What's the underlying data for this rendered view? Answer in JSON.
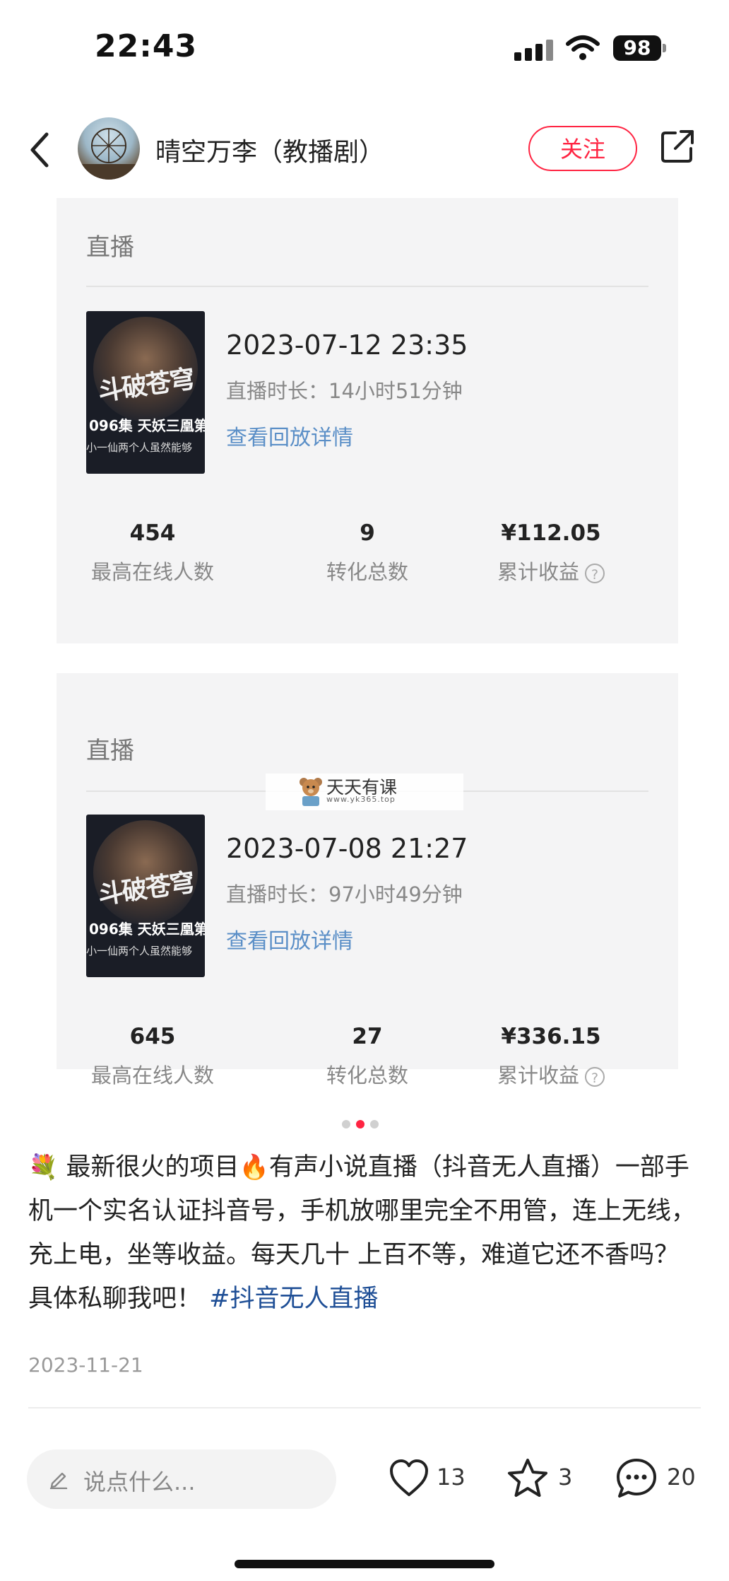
{
  "status_bar": {
    "time": "22:43",
    "battery": "98"
  },
  "header": {
    "author": "晴空万李（教播剧）",
    "follow_label": "关注"
  },
  "media": {
    "cards": [
      {
        "label": "直播",
        "cover_title": "斗破苍穹",
        "cover_episode": "096集 天妖三凰第",
        "cover_subtitle": "小一仙两个人虽然能够",
        "date": "2023-07-12 23:35",
        "duration": "直播时长：14小时51分钟",
        "replay": "查看回放详情",
        "stats": [
          {
            "num": "454",
            "cap": "最高在线人数"
          },
          {
            "num": "9",
            "cap": "转化总数"
          },
          {
            "num": "¥112.05",
            "cap": "累计收益"
          }
        ]
      },
      {
        "label": "直播",
        "cover_title": "斗破苍穹",
        "cover_episode": "096集 天妖三凰第",
        "cover_subtitle": "小一仙两个人虽然能够",
        "date": "2023-07-08 21:27",
        "duration": "直播时长：97小时49分钟",
        "replay": "查看回放详情",
        "stats": [
          {
            "num": "645",
            "cap": "最高在线人数"
          },
          {
            "num": "27",
            "cap": "转化总数"
          },
          {
            "num": "¥336.15",
            "cap": "累计收益"
          }
        ]
      }
    ],
    "watermark": {
      "title": "天天有课",
      "url": "www.yk365.top"
    },
    "help_symbol": "?",
    "carousel": {
      "total": 3,
      "active": 2
    }
  },
  "post": {
    "emoji_bouquet": "💐",
    "text_1": "最新很火的项目",
    "emoji_fire": "🔥",
    "text_2": "有声小说直播（抖音无人直播）一部手机一个实名认证抖音号，手机放哪里完全不用管，连上无线，充上电，坐等收益。每天几十 上百不等，难道它还不香吗？具体私聊我吧！",
    "hashtag": "#抖音无人直播",
    "date": "2023-11-21"
  },
  "bottom_bar": {
    "comment_placeholder": "说点什么...",
    "likes": "13",
    "collects": "3",
    "comments": "20"
  },
  "colors": {
    "accent": "#ff2442",
    "link": "#5b8fc7",
    "hashtag": "#1f4f96"
  }
}
